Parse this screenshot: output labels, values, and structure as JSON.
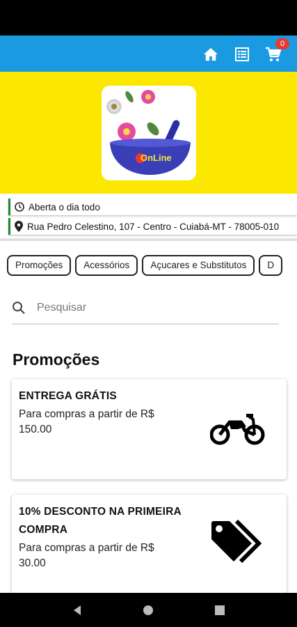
{
  "header": {
    "cart_count": "0",
    "icons": [
      "home-icon",
      "list-icon",
      "cart-icon"
    ],
    "color": "#1a9be1"
  },
  "hero": {
    "background": "#fce700",
    "logo_text": "OnLine"
  },
  "store": {
    "hours": "Aberta o dia todo",
    "address": "Rua Pedro Celestino, 107 - Centro - Cuiabá-MT - 78005-010"
  },
  "categories": [
    "Promoções",
    "Acessórios",
    "Açucares e Substitutos",
    "D"
  ],
  "search": {
    "placeholder": "Pesquisar"
  },
  "promotions": {
    "title": "Promoções",
    "items": [
      {
        "title": "ENTREGA GRÁTIS",
        "description": "Para compras a partir de R$ 150.00",
        "icon": "motorcycle-icon"
      },
      {
        "title": "10% DESCONTO NA PRIMEIRA COMPRA",
        "description": "Para compras a partir de R$ 30.00",
        "icon": "tags-icon"
      }
    ]
  }
}
